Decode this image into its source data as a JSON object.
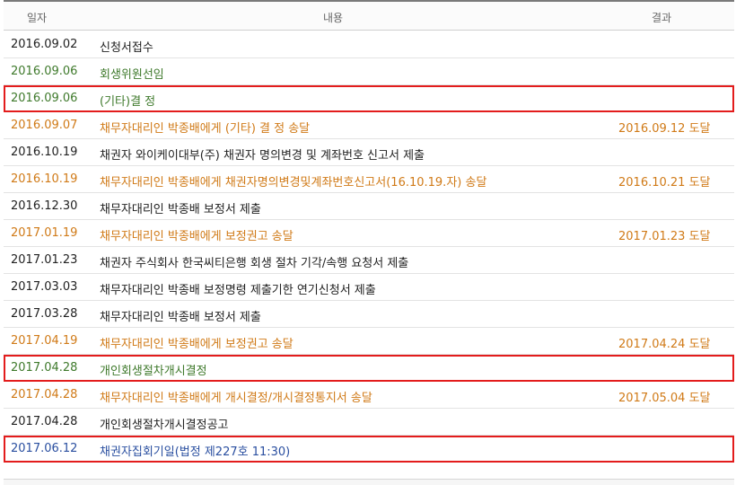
{
  "header": {
    "date": "일자",
    "content": "내용",
    "result": "결과"
  },
  "rows": [
    {
      "date": "2016.09.02",
      "content": "신청서접수",
      "result": ""
    },
    {
      "date": "2016.09.06",
      "content": "회생위원선임",
      "result": ""
    },
    {
      "date": "2016.09.06",
      "content": "(기타)결 정",
      "result": ""
    },
    {
      "date": "2016.09.07",
      "content": "채무자대리인 박종배에게 (기타) 결 정 송달",
      "result": "2016.09.12 도달"
    },
    {
      "date": "2016.10.19",
      "content": "채권자 와이케이대부(주) 채권자 명의변경 및 계좌번호 신고서 제출",
      "result": ""
    },
    {
      "date": "2016.10.19",
      "content": "채무자대리인 박종배에게 채권자명의변경및계좌번호신고서(16.10.19.자) 송달",
      "result": "2016.10.21 도달"
    },
    {
      "date": "2016.12.30",
      "content": "채무자대리인 박종배 보정서 제출",
      "result": ""
    },
    {
      "date": "2017.01.19",
      "content": "채무자대리인 박종배에게 보정권고 송달",
      "result": "2017.01.23 도달"
    },
    {
      "date": "2017.01.23",
      "content": "채권자 주식회사 한국씨티은행 회생 절차 기각/속행 요청서 제출",
      "result": ""
    },
    {
      "date": "2017.03.03",
      "content": "채무자대리인 박종배 보정명령 제출기한 연기신청서 제출",
      "result": ""
    },
    {
      "date": "2017.03.28",
      "content": "채무자대리인 박종배 보정서 제출",
      "result": ""
    },
    {
      "date": "2017.04.19",
      "content": "채무자대리인 박종배에게 보정권고 송달",
      "result": "2017.04.24 도달"
    },
    {
      "date": "2017.04.28",
      "content": "개인회생절차개시결정",
      "result": ""
    },
    {
      "date": "2017.04.28",
      "content": "채무자대리인 박종배에게 개시결정/개시결정통지서 송달",
      "result": "2017.05.04 도달"
    },
    {
      "date": "2017.04.28",
      "content": "개인회생절차개시결정공고",
      "result": ""
    },
    {
      "date": "2017.06.12",
      "content": "채권자집회기일(법정 제227호 11:30)",
      "result": ""
    }
  ],
  "colors": {
    "black": "#222222",
    "orange": "#d07a17",
    "green": "#3f7a2c",
    "blue": "#2a4fa0",
    "highlight": "#e31c1c"
  }
}
